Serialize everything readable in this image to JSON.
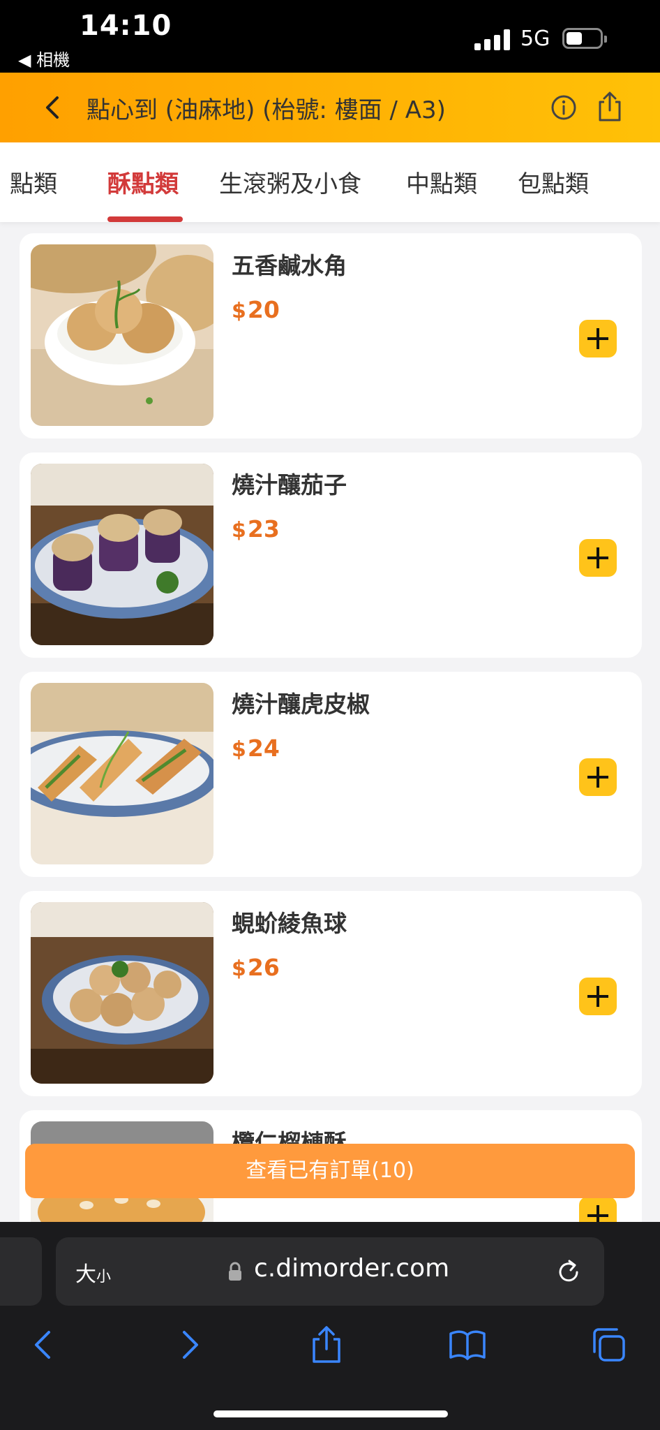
{
  "status_bar": {
    "time": "14:10",
    "back_app": "◀ 相機",
    "network": "5G",
    "battery_level": 0.4
  },
  "header": {
    "title": "點心到 (油麻地) (枱號: 樓面 / A3)",
    "back_icon": "chevron-left-icon",
    "info_icon": "info-icon",
    "share_icon": "share-icon"
  },
  "tabs": [
    {
      "label": "點類",
      "active": false
    },
    {
      "label": "酥點類",
      "active": true
    },
    {
      "label": "生滾粥及小食",
      "active": false
    },
    {
      "label": "中點類",
      "active": false
    },
    {
      "label": "包點類",
      "active": false
    }
  ],
  "items": [
    {
      "name": "五香鹹水角",
      "currency": "$",
      "price": "20"
    },
    {
      "name": "燒汁釀茄子",
      "currency": "$",
      "price": "23"
    },
    {
      "name": "燒汁釀虎皮椒",
      "currency": "$",
      "price": "24"
    },
    {
      "name": "蜆蚧綾魚球",
      "currency": "$",
      "price": "26"
    },
    {
      "name": "欖仁榴槤酥",
      "currency": "$",
      "price": ""
    }
  ],
  "order_button": {
    "label": "查看已有訂單(10)"
  },
  "browser": {
    "text_size_label": "大",
    "text_size_small": "小",
    "url": "c.dimorder.com",
    "icons": [
      "back-icon",
      "forward-icon",
      "share-icon",
      "bookmarks-icon",
      "tabs-icon"
    ]
  },
  "colors": {
    "header_start": "#ffa000",
    "header_end": "#ffc107",
    "active_tab": "#d23a3a",
    "price": "#e86f1f",
    "add_button": "#ffc31a",
    "order_button": "#ff9a3d",
    "browser_icon": "#3a86ff"
  }
}
